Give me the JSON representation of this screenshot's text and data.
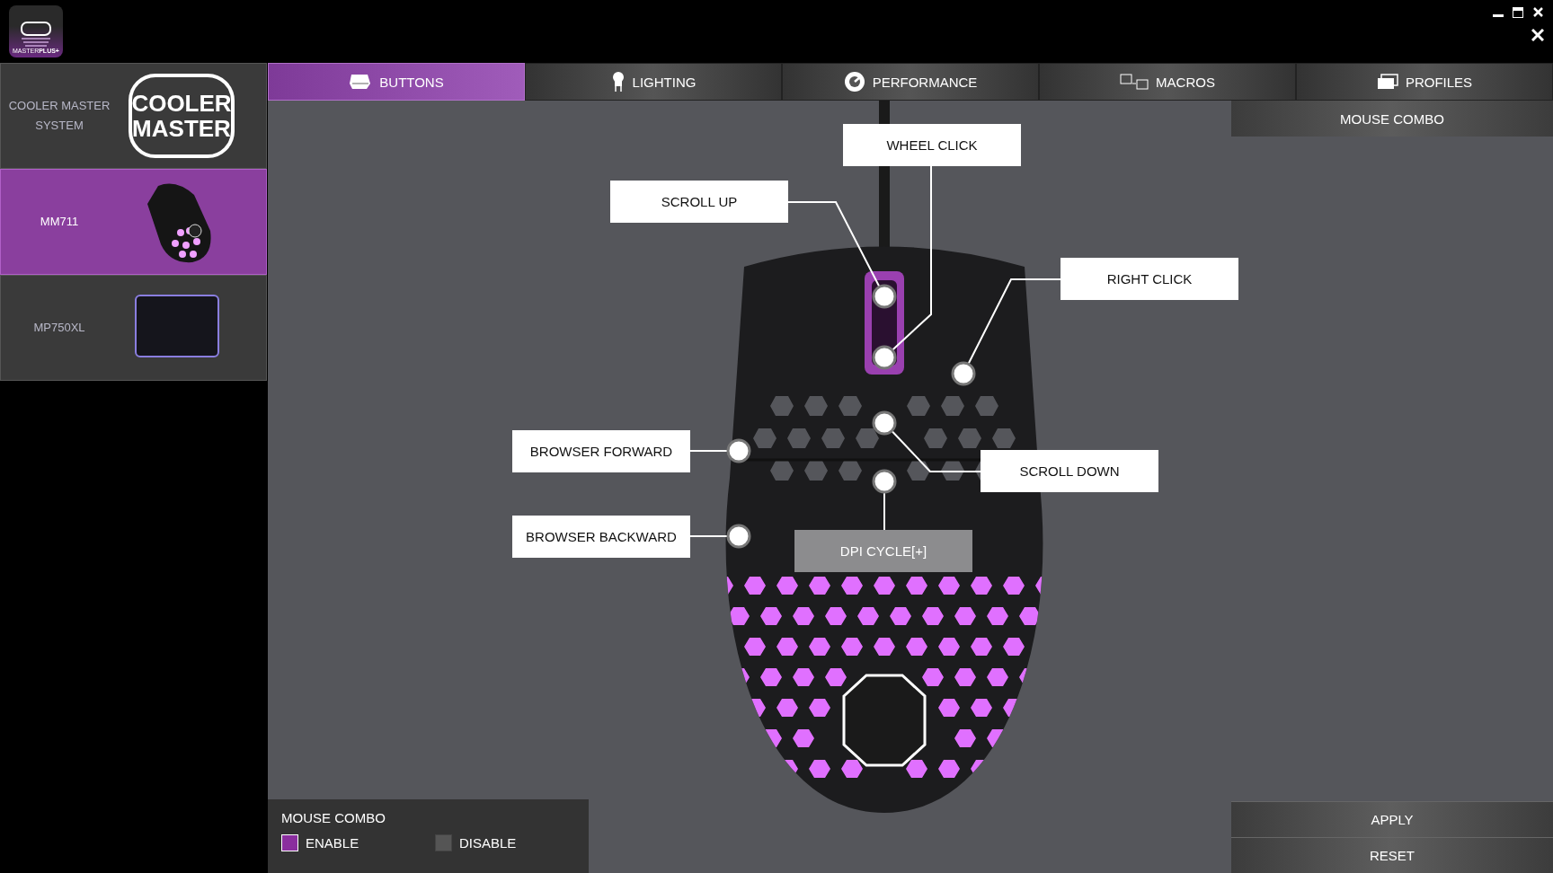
{
  "app": {
    "icon_label": "MASTER**PLUS+**"
  },
  "sidebar": {
    "items": [
      {
        "name": "COOLER MASTER SYSTEM",
        "kind": "system",
        "logo_text": [
          "COOLER",
          "MASTER"
        ],
        "selected": false
      },
      {
        "name": "MM711",
        "kind": "mouse",
        "selected": true
      },
      {
        "name": "MP750XL",
        "kind": "mousepad",
        "selected": false
      }
    ]
  },
  "tabs": [
    {
      "label": "BUTTONS",
      "kind": "buttons",
      "selected": true
    },
    {
      "label": "LIGHTING",
      "kind": "lighting",
      "selected": false
    },
    {
      "label": "PERFORMANCE",
      "kind": "performance",
      "selected": false
    },
    {
      "label": "MACROS",
      "kind": "macros",
      "selected": false
    },
    {
      "label": "PROFILES",
      "kind": "profiles",
      "selected": false
    }
  ],
  "mouse_combo_button": "MOUSE COMBO",
  "button_labels": [
    {
      "label": "WHEEL CLICK",
      "selected": false
    },
    {
      "label": "SCROLL UP",
      "selected": false
    },
    {
      "label": "RIGHT CLICK",
      "selected": false
    },
    {
      "label": "BROWSER FORWARD",
      "selected": false
    },
    {
      "label": "SCROLL DOWN",
      "selected": false
    },
    {
      "label": "BROWSER BACKWARD",
      "selected": false
    },
    {
      "label": "DPI CYCLE[+]",
      "selected": true
    }
  ],
  "mouse_combo": {
    "title": "MOUSE COMBO",
    "options": [
      {
        "label": "ENABLE",
        "checked": true
      },
      {
        "label": "DISABLE",
        "checked": false
      }
    ]
  },
  "actions": [
    "APPLY",
    "RESET"
  ]
}
